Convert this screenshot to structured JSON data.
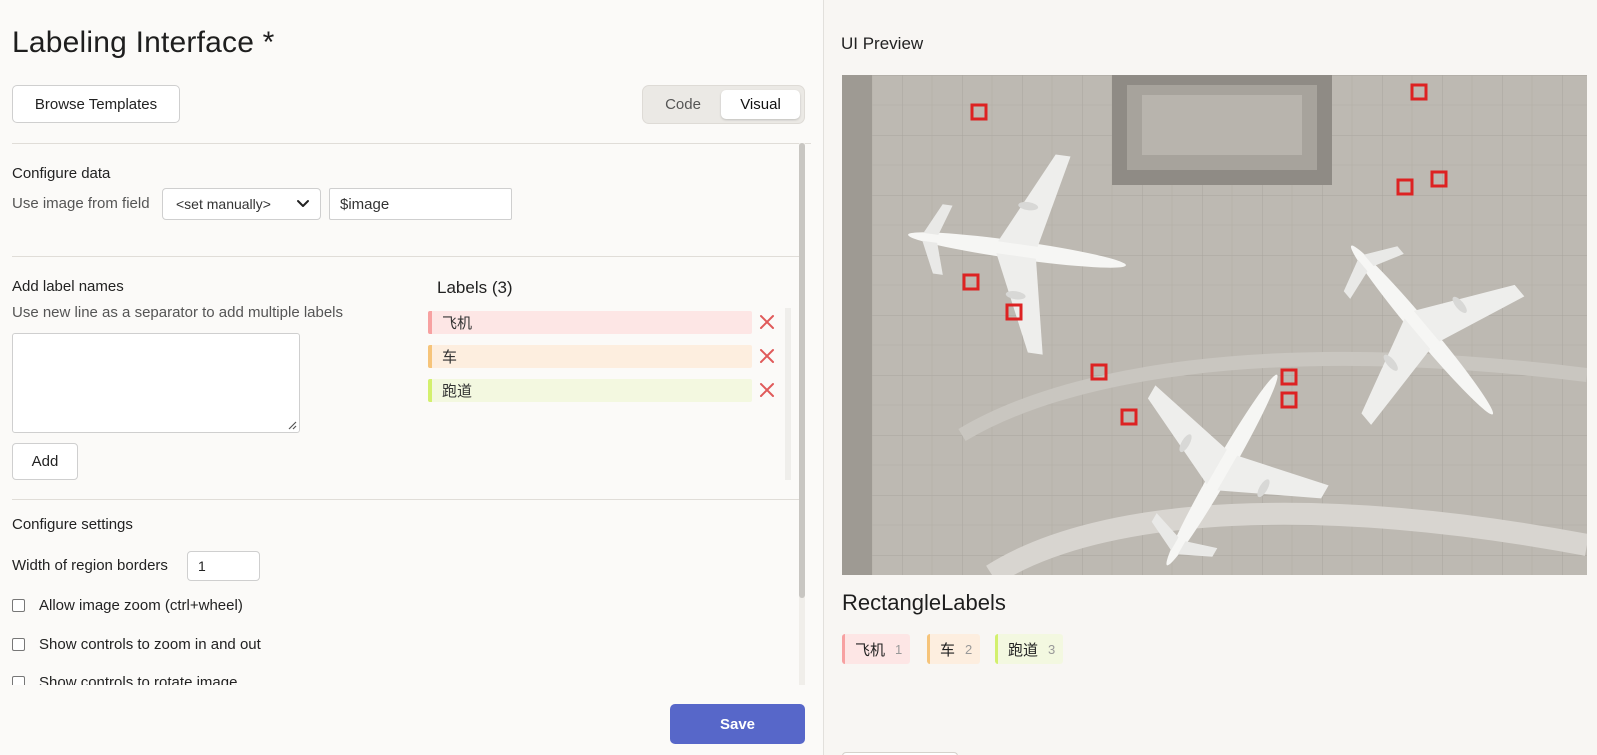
{
  "header": {
    "title": "Labeling Interface *",
    "browse_templates": "Browse Templates",
    "mode_tabs": {
      "code": "Code",
      "visual": "Visual"
    }
  },
  "configure_data": {
    "section_title": "Configure data",
    "field_label": "Use image from field",
    "select_value": "<set manually>",
    "field_value": "$image"
  },
  "label_names": {
    "section_title": "Add label names",
    "hint": "Use new line as a separator to add multiple labels",
    "textarea_value": "",
    "add_button": "Add"
  },
  "labels": {
    "title": "Labels (3)",
    "items": [
      {
        "name": "飞机",
        "color": "#f7a1a1",
        "bg": "#fde6e5"
      },
      {
        "name": "车",
        "color": "#f6c47a",
        "bg": "#fdeedf"
      },
      {
        "name": "跑道",
        "color": "#d3f06e",
        "bg": "#f3f8e0"
      }
    ]
  },
  "configure_settings": {
    "section_title": "Configure settings",
    "border_width_label": "Width of region borders",
    "border_width_value": "1",
    "options": [
      {
        "label": "Allow image zoom (ctrl+wheel)",
        "checked": false
      },
      {
        "label": "Show controls to zoom in and out",
        "checked": false
      },
      {
        "label": "Show controls to rotate image",
        "checked": false
      }
    ]
  },
  "save_button": "Save",
  "preview": {
    "title": "UI Preview",
    "control_title": "RectangleLabels",
    "chips": [
      {
        "name": "飞机",
        "hotkey": "1"
      },
      {
        "name": "车",
        "hotkey": "2"
      },
      {
        "name": "跑道",
        "hotkey": "3"
      }
    ]
  },
  "colors": {
    "accent": "#5767c9",
    "delete_icon": "#e05a5a"
  }
}
